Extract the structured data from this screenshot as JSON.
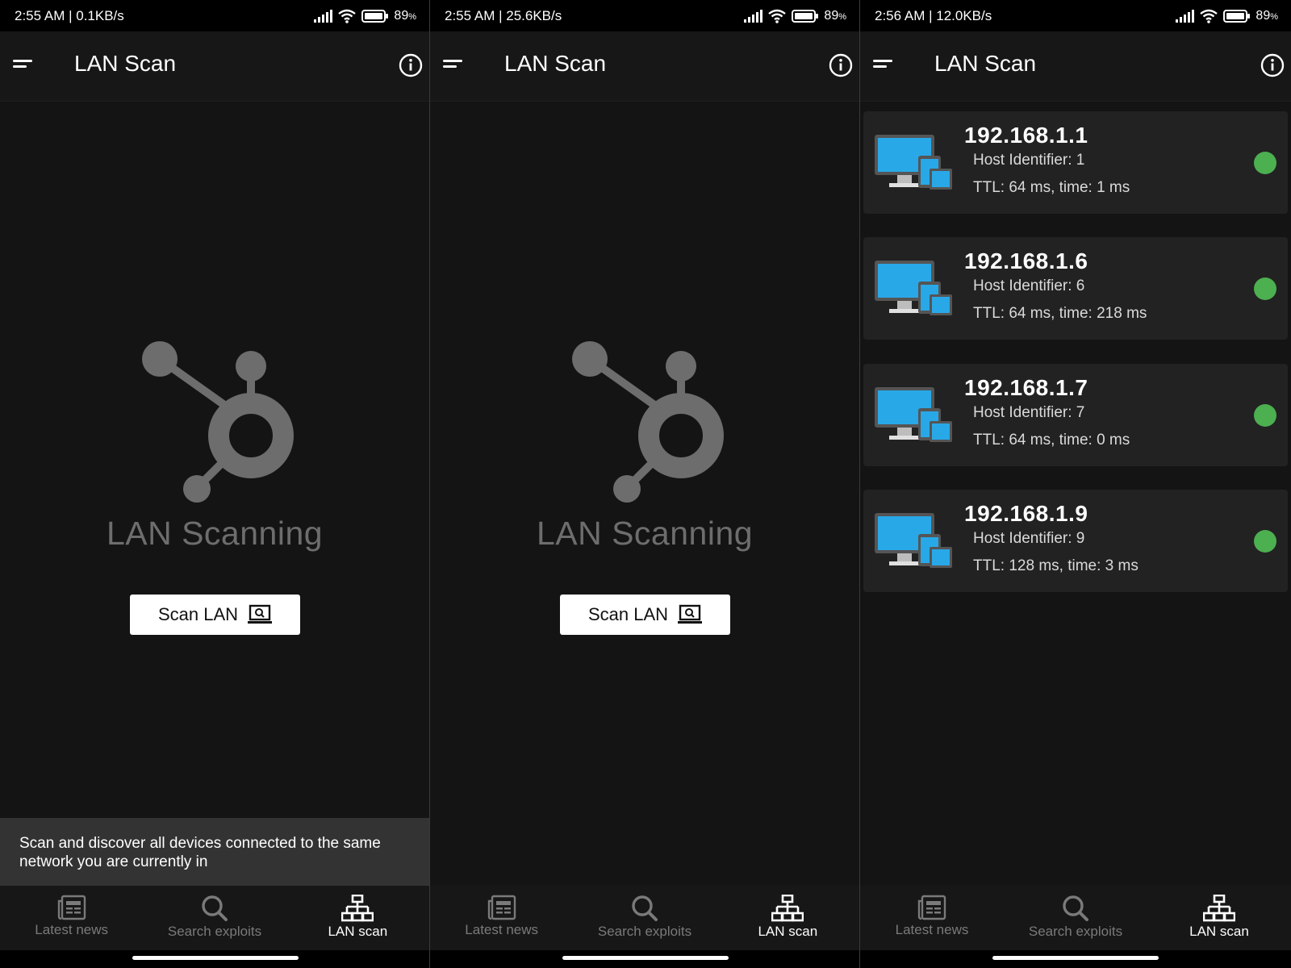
{
  "screens": [
    {
      "status": {
        "time_net": "2:55 AM | 0.1KB/s",
        "battery": "89",
        "battery_unit": "%"
      },
      "app_title": "LAN Scan",
      "empty_title": "LAN Scanning",
      "scan_button": "Scan LAN",
      "snackbar": "Scan and discover all devices connected to the same network you are currently in",
      "nav": [
        "Latest news",
        "Search exploits",
        "LAN scan"
      ]
    },
    {
      "status": {
        "time_net": "2:55 AM | 25.6KB/s",
        "battery": "89",
        "battery_unit": "%"
      },
      "app_title": "LAN Scan",
      "empty_title": "LAN Scanning",
      "scan_button": "Scan LAN",
      "nav": [
        "Latest news",
        "Search exploits",
        "LAN scan"
      ]
    },
    {
      "status": {
        "time_net": "2:56 AM | 12.0KB/s",
        "battery": "89",
        "battery_unit": "%"
      },
      "app_title": "LAN Scan",
      "devices": [
        {
          "ip": "192.168.1.1",
          "host": "Host Identifier: 1",
          "ttl": "TTL: 64 ms, time: 1 ms"
        },
        {
          "ip": "192.168.1.6",
          "host": "Host Identifier: 6",
          "ttl": "TTL: 64 ms, time: 218 ms"
        },
        {
          "ip": "192.168.1.7",
          "host": "Host Identifier: 7",
          "ttl": "TTL: 64 ms, time: 0 ms"
        },
        {
          "ip": "192.168.1.9",
          "host": "Host Identifier: 9",
          "ttl": "TTL: 128 ms, time: 3 ms"
        }
      ],
      "nav": [
        "Latest news",
        "Search exploits",
        "LAN scan"
      ]
    }
  ],
  "colors": {
    "online": "#4caf50",
    "device_screen": "#29a8e8",
    "icon_gray": "#6d6d6d"
  },
  "icons": {
    "menu": "menu-icon",
    "info": "info-icon",
    "nav": [
      "newspaper-icon",
      "search-icon",
      "network-icon"
    ]
  }
}
